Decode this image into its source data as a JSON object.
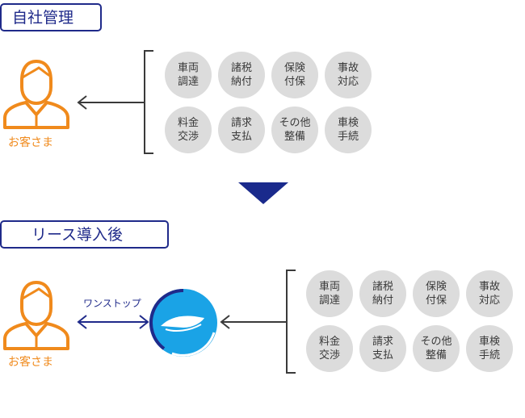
{
  "before": {
    "title": "自社管理",
    "customer_label": "お客さま",
    "services": [
      "車両\n調達",
      "諸税\n納付",
      "保険\n付保",
      "事故\n対応",
      "料金\n交渉",
      "請求\n支払",
      "その他\n整備",
      "車検\n手続"
    ]
  },
  "after": {
    "title": "リース導入後",
    "customer_label": "お客さま",
    "onestop_label": "ワンストップ",
    "services": [
      "車両\n調達",
      "諸税\n納付",
      "保険\n付保",
      "事故\n対応",
      "料金\n交渉",
      "請求\n支払",
      "その他\n整備",
      "車検\n手続"
    ]
  },
  "colors": {
    "navy": "#1f2a8a",
    "orange": "#f08a1c",
    "circle_gray": "#dcdcdc",
    "logo_blue": "#1aa3e6"
  },
  "icons": [
    "person-icon",
    "down-triangle-icon",
    "company-logo-icon"
  ]
}
